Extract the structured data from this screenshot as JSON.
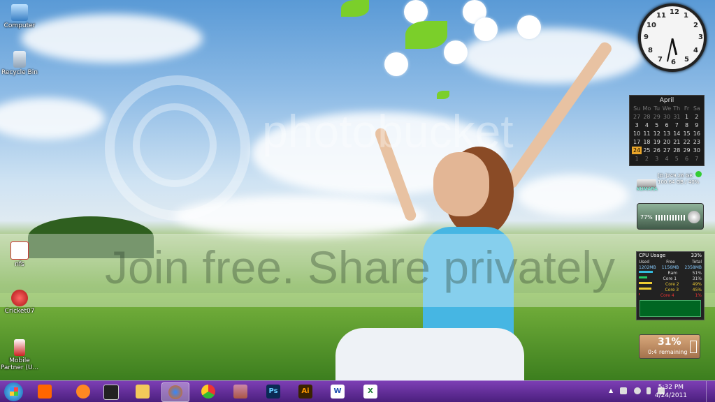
{
  "desktop": {
    "icons": [
      {
        "name": "computer",
        "label": "Computer"
      },
      {
        "name": "recycle-bin",
        "label": "Recycle Bin"
      },
      {
        "name": "nfs",
        "label": "nfs"
      },
      {
        "name": "cricket07",
        "label": "Cricket07"
      },
      {
        "name": "mobile-partner",
        "label": "Mobile Partner (U..."
      }
    ],
    "watermark": {
      "brand": "photobucket",
      "tagline": "Join free. Share privately"
    }
  },
  "gadgets": {
    "clock": {
      "hour": 5,
      "minute": 32
    },
    "calendar": {
      "month": "April",
      "weekdays": [
        "Su",
        "Mo",
        "Tu",
        "We",
        "Th",
        "Fr",
        "Sa"
      ],
      "weeks": [
        [
          "27",
          "28",
          "29",
          "30",
          "31",
          "1",
          "2"
        ],
        [
          "3",
          "4",
          "5",
          "6",
          "7",
          "8",
          "9"
        ],
        [
          "10",
          "11",
          "12",
          "13",
          "14",
          "15",
          "16"
        ],
        [
          "17",
          "18",
          "19",
          "20",
          "21",
          "22",
          "23"
        ],
        [
          "24",
          "25",
          "26",
          "27",
          "28",
          "29",
          "30"
        ],
        [
          "1",
          "2",
          "3",
          "4",
          "5",
          "6",
          "7"
        ]
      ],
      "today": "24"
    },
    "drive": {
      "line1": "[D:]249.26 GB",
      "line2": "100.64 GB / 40%",
      "label": "KUMARA"
    },
    "volume": {
      "level": "77%"
    },
    "cpu": {
      "title": "CPU Usage",
      "usage": "33%",
      "headers": [
        "Used",
        "Free",
        "Total"
      ],
      "values": [
        "1202MB",
        "1156MB",
        "2358MB"
      ],
      "rows": [
        {
          "label": "Ram",
          "value": "51%"
        },
        {
          "label": "Core 1",
          "value": "31%"
        },
        {
          "label": "Core 2",
          "value": "49%"
        },
        {
          "label": "Core 3",
          "value": "45%"
        },
        {
          "label": "Core 4",
          "value": "1%"
        }
      ]
    },
    "battery": {
      "percent": "31%",
      "remaining": "0:4",
      "remaining_label": "remaining"
    }
  },
  "taskbar": {
    "apps": [
      {
        "name": "windows-media-player"
      },
      {
        "name": "nero"
      },
      {
        "name": "kinemaster"
      },
      {
        "name": "file-explorer"
      },
      {
        "name": "firefox"
      },
      {
        "name": "chrome"
      },
      {
        "name": "winrar"
      },
      {
        "name": "photoshop",
        "text": "Ps"
      },
      {
        "name": "illustrator",
        "text": "Ai"
      },
      {
        "name": "word",
        "text": "W"
      },
      {
        "name": "excel",
        "text": "X"
      }
    ],
    "time": "5:32 PM",
    "date": "4/24/2011"
  }
}
